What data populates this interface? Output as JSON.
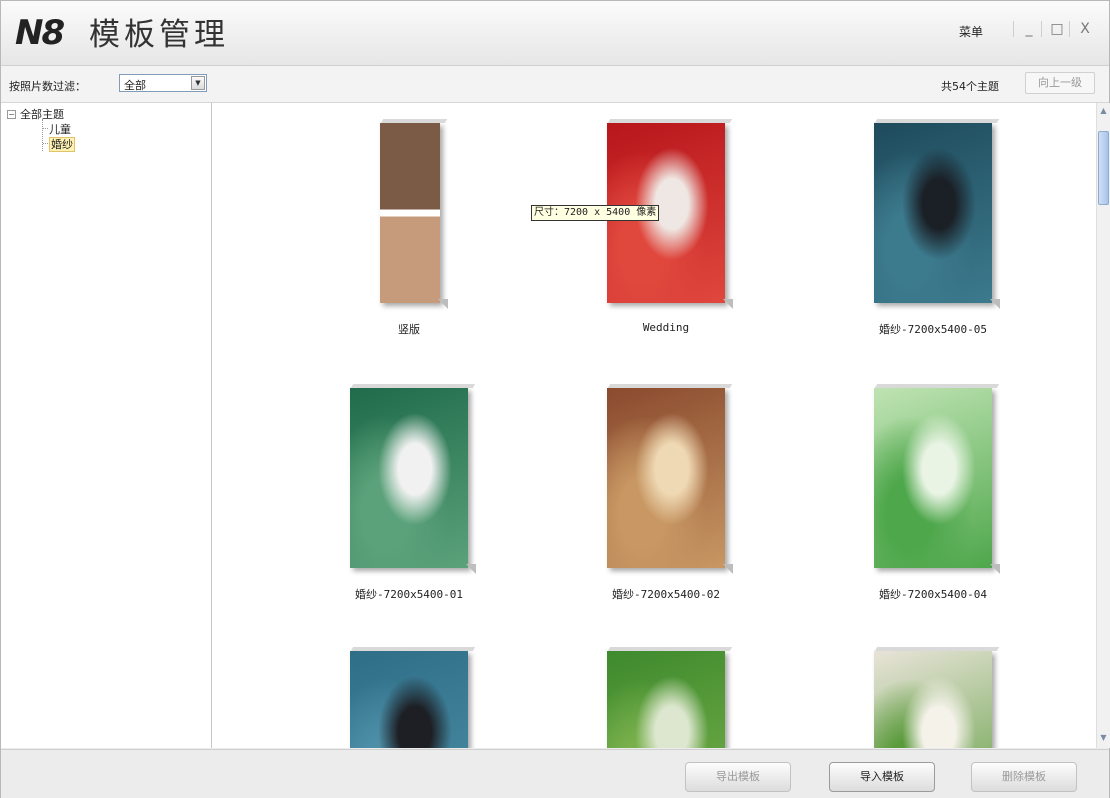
{
  "app": {
    "logo": "N8",
    "title": "模板管理",
    "menu_label": "菜单",
    "minimize_glyph": "_",
    "maximize_glyph": "□",
    "close_glyph": "X"
  },
  "toolbar": {
    "filter_label": "按照片数过滤：",
    "filter_value": "全部",
    "count_text": "共54个主题",
    "up_level_label": "向上一级"
  },
  "tree": {
    "root": "全部主题",
    "children": [
      "儿童",
      "婚纱"
    ],
    "selected_index": 1
  },
  "gallery": {
    "tooltip": "尺寸：7200 x 5400 像素",
    "items": [
      {
        "caption": "竖版",
        "colors": [
          "#7b5a46",
          "#c59b7c",
          "#3e2f28"
        ]
      },
      {
        "caption": "Wedding",
        "colors": [
          "#b8161b",
          "#e0473d",
          "#efe7e3"
        ]
      },
      {
        "caption": "婚纱-7200x5400-05",
        "colors": [
          "#1e4b5c",
          "#3c7a8d",
          "#1b2027"
        ]
      },
      {
        "caption": "婚纱-7200x5400-01",
        "colors": [
          "#1f6b4b",
          "#5ba27a",
          "#f1f1f1"
        ]
      },
      {
        "caption": "婚纱-7200x5400-02",
        "colors": [
          "#8a4a2e",
          "#c89763",
          "#efd9b4"
        ]
      },
      {
        "caption": "婚纱-7200x5400-04",
        "colors": [
          "#bfe3b3",
          "#4ea74b",
          "#e9f4e4"
        ]
      },
      {
        "caption": "",
        "colors": [
          "#2f6e87",
          "#4d8fa8",
          "#1d1f24"
        ]
      },
      {
        "caption": "",
        "colors": [
          "#3e8a2d",
          "#79b04c",
          "#dde7cf"
        ]
      },
      {
        "caption": "",
        "colors": [
          "#e8e4d8",
          "#5a9a3b",
          "#f5f2ea"
        ]
      }
    ]
  },
  "footer": {
    "export_label": "导出模板",
    "import_label": "导入模板",
    "delete_label": "删除模板"
  }
}
